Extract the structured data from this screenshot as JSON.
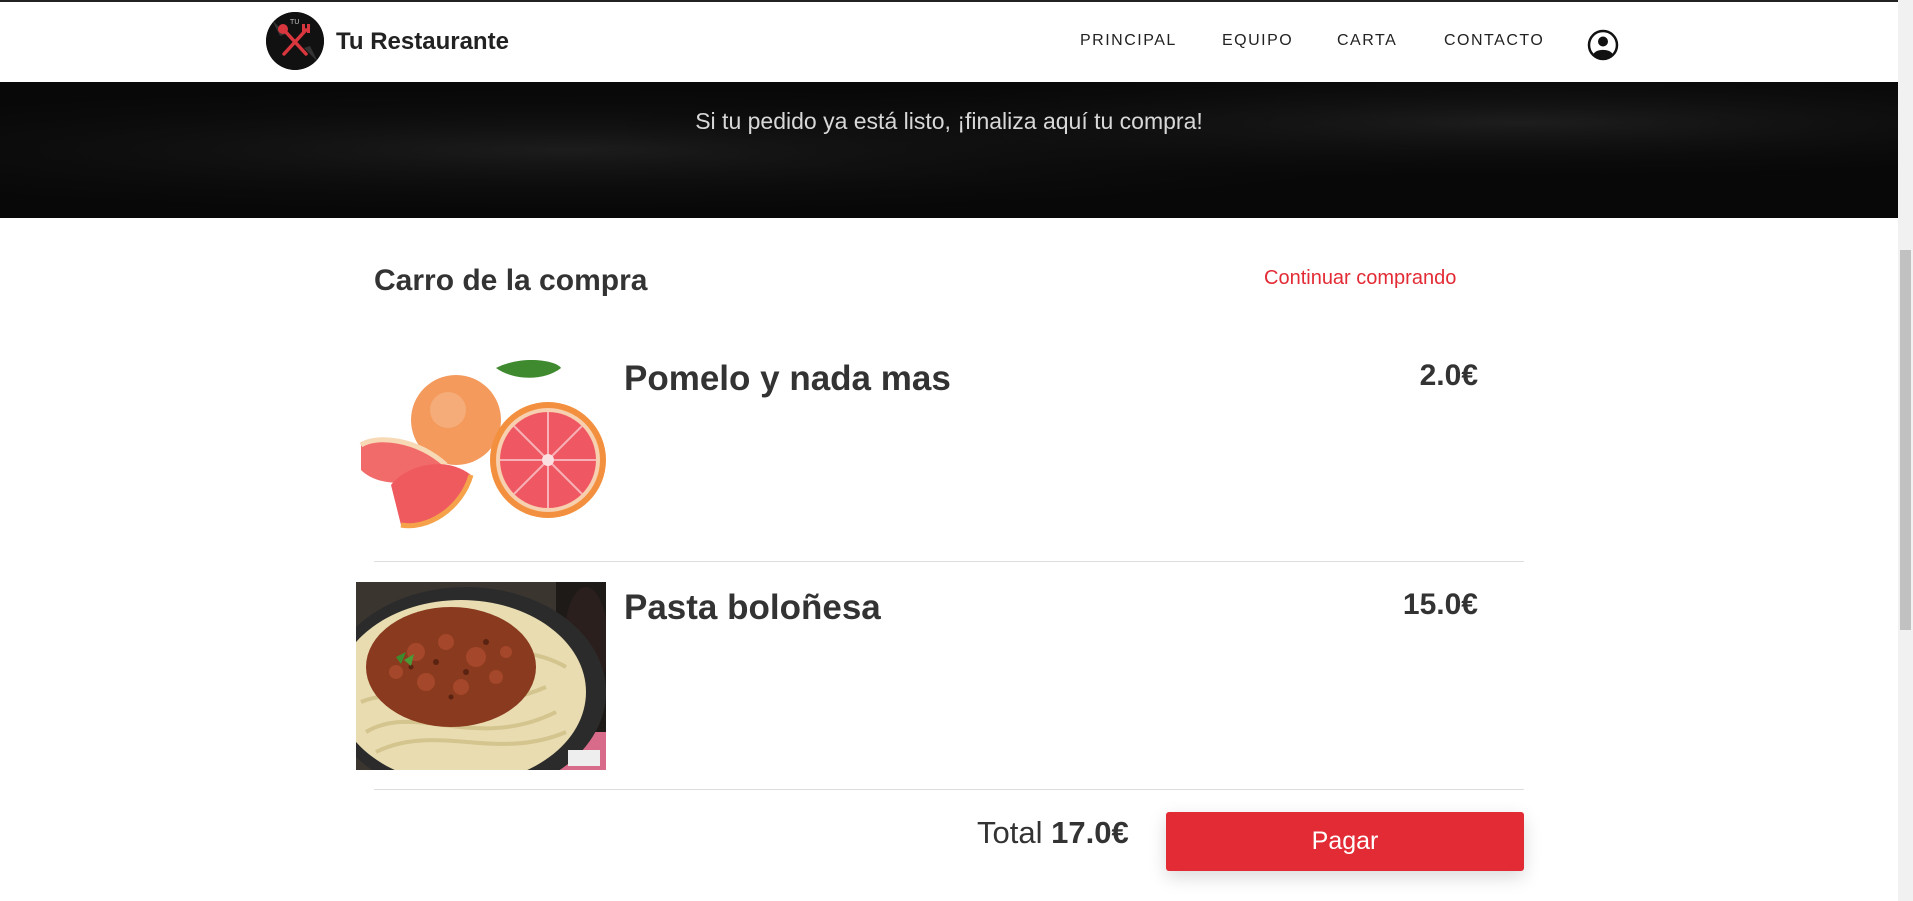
{
  "header": {
    "brand": "Tu Restaurante",
    "nav": [
      "PRINCIPAL",
      "EQUIPO",
      "CARTA",
      "CONTACTO"
    ]
  },
  "hero": {
    "text": "Si tu pedido ya está listo, ¡finaliza aquí tu compra!"
  },
  "cart": {
    "title": "Carro de la compra",
    "continue_label": "Continuar comprando",
    "items": [
      {
        "name": "Pomelo y nada mas",
        "price": "2.0€"
      },
      {
        "name": "Pasta boloñesa",
        "price": "15.0€"
      }
    ],
    "total_label": "Total",
    "total_value": "17.0€",
    "pay_label": "Pagar"
  },
  "colors": {
    "accent": "#e32b35",
    "hero_bg": "#080808"
  },
  "icons": [
    "restaurant-logo-icon",
    "user-profile-icon"
  ]
}
